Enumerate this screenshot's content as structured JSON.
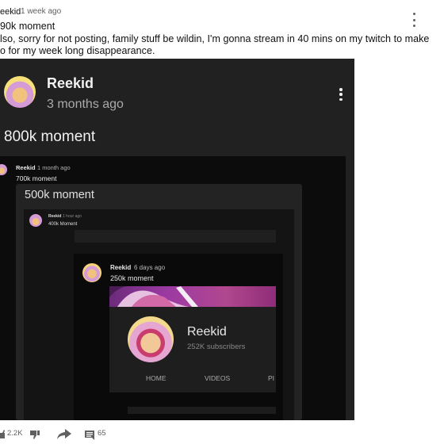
{
  "post": {
    "author": "eekid",
    "time": "1 week ago",
    "lines": [
      "90k moment",
      "lso, sorry for not posting, family stuff be wildin, I'm gonna stream in 40 mins on my twitch to make",
      "o for my week long disappearance."
    ]
  },
  "embed": {
    "author": "Reekid",
    "time": "3 months ago",
    "title": "800k moment",
    "level1": {
      "author": "Reekid",
      "time": "1 month ago",
      "text": "700k moment"
    },
    "level2": {
      "title": "500k moment"
    },
    "level3": {
      "author": "Reekid",
      "time": "1 hour ago",
      "text": "400k Moment"
    },
    "level4": {
      "author": "Reekid",
      "time": "6 days ago",
      "text": "250k moment"
    },
    "channel": {
      "name": "Reekid",
      "subscribers": "252K subscribers",
      "tabs": [
        "HOME",
        "VIDEOS",
        "PI"
      ]
    }
  },
  "toolbar": {
    "likes": "2.2K",
    "comments": "65"
  },
  "colors": {
    "dark_bg": "#212121",
    "banner": "#9c3aa3",
    "text_secondary": "#606060"
  }
}
